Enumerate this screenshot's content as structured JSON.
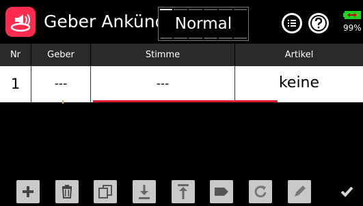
{
  "header": {
    "title": "Geber Ankünd.",
    "mode": "Normal",
    "battery_percent": "99%",
    "app_icon": "speaker-announce-icon",
    "accent_color": "#ff2b4f"
  },
  "table": {
    "columns": [
      "Nr",
      "Geber",
      "Stimme",
      "Artikel"
    ],
    "rows": [
      {
        "nr": "1",
        "geber": "---",
        "stimme": "---",
        "artikel": "keine"
      }
    ]
  },
  "toolbar": {
    "icons": [
      "plus-icon",
      "trash-icon",
      "copy-icon",
      "download-icon",
      "upload-icon",
      "tag-icon",
      "refresh-icon",
      "pencil-icon",
      "checkmark-icon"
    ]
  }
}
